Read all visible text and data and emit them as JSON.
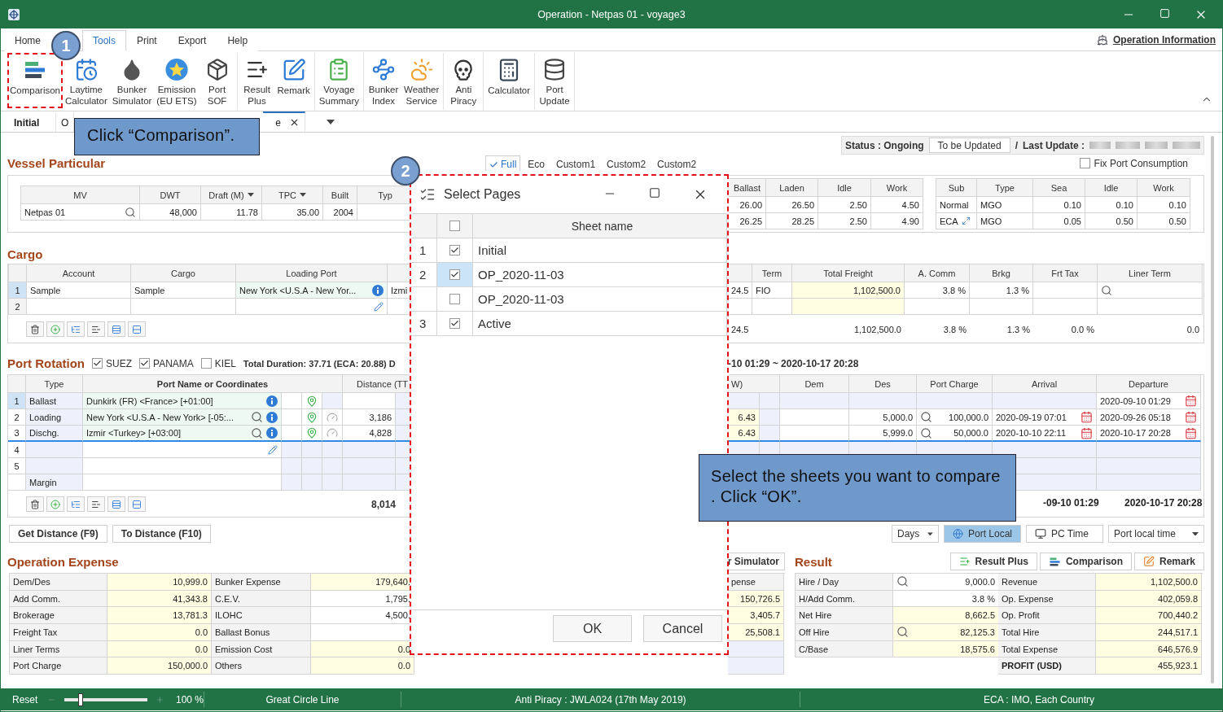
{
  "window": {
    "title": "Operation - Netpas 01 - voyage3"
  },
  "menu": [
    {
      "label": "Home",
      "selected": false
    },
    {
      "label": "Tools",
      "selected": true
    },
    {
      "label": "Print",
      "selected": false
    },
    {
      "label": "Export",
      "selected": false
    },
    {
      "label": "Help",
      "selected": false
    }
  ],
  "operation_information": "Operation Information",
  "ribbon": [
    [
      {
        "label": "Comparison",
        "highlighted": true
      },
      {
        "label": "Laytime\nCalculator",
        "highlighted": false
      },
      {
        "label": "Bunker\nSimulator",
        "highlighted": false
      },
      {
        "label": "Emission\n(EU ETS)",
        "highlighted": false
      },
      {
        "label": "Port\nSOF",
        "highlighted": false
      }
    ],
    [
      {
        "label": "Result\nPlus",
        "highlighted": false
      },
      {
        "label": "Remark",
        "highlighted": false
      }
    ],
    [
      {
        "label": "Voyage\nSummary",
        "highlighted": false
      }
    ],
    [
      {
        "label": "Bunker\nIndex",
        "highlighted": false
      },
      {
        "label": "Weather\nService",
        "highlighted": false
      }
    ],
    [
      {
        "label": "Anti\nPiracy",
        "highlighted": false
      }
    ],
    [
      {
        "label": "Calculator",
        "highlighted": false
      }
    ],
    [
      {
        "label": "Port\nUpdate",
        "highlighted": false
      }
    ]
  ],
  "sheet_tabs": [
    {
      "label": "Initial",
      "selected": false,
      "closable": false
    },
    {
      "label": "O",
      "selected": false,
      "closable": false
    },
    {
      "label": "e",
      "selected": true,
      "closable": true
    }
  ],
  "status": {
    "label": "Status : Ongoing",
    "button": "To be Updated",
    "separator": "/",
    "last_update": "Last Update :"
  },
  "vessel": {
    "title": "Vessel Particular",
    "view_modes": [
      {
        "label": "Full",
        "selected": true
      },
      {
        "label": "Eco",
        "selected": false
      },
      {
        "label": "Custom1",
        "selected": false
      },
      {
        "label": "Custom2",
        "selected": false
      },
      {
        "label": "Custom2",
        "selected": false
      }
    ],
    "fix_port_consumption": {
      "label": "Fix Port Consumption",
      "checked": false
    },
    "particulars": {
      "columns": [
        "MV",
        "DWT",
        "Draft (M)",
        "TPC",
        "Built",
        "Typ"
      ],
      "rows": [
        [
          "Netpas 01",
          "48,000",
          "11.78",
          "35.00",
          "2004"
        ]
      ]
    },
    "speeds": {
      "columns": [
        "Ballast",
        "Laden",
        "Idle",
        "Work"
      ],
      "rows": [
        [
          "26.00",
          "26.50",
          "2.50",
          "4.50"
        ],
        [
          "26.25",
          "28.25",
          "2.50",
          "4.90"
        ]
      ]
    },
    "consumption": {
      "columns": [
        "Sub",
        "Type",
        "Sea",
        "Idle",
        "Work"
      ],
      "rows": [
        [
          "Normal",
          "MGO",
          "0.10",
          "0.10",
          "0.10"
        ],
        [
          "ECA",
          "MGO",
          "0.05",
          "0.50",
          "0.50"
        ]
      ]
    }
  },
  "cargo": {
    "title": "Cargo",
    "columns": [
      "Account",
      "Cargo",
      "Loading Port"
    ],
    "rows": [
      {
        "no": "1",
        "selected": true,
        "account": "Sample",
        "cargo": "Sample",
        "loading_port": "New York <U.S.A - New Yor...",
        "column_4": "Izmi",
        "column_5": "24.5",
        "term": "FIO",
        "total_freight": "1,102,500.0",
        "a_comm": "3.8 %",
        "brkg": "1.3 %"
      },
      {
        "no": "2",
        "selected": false
      }
    ],
    "right_columns": [
      "Term",
      "Total Freight",
      "A. Comm",
      "Brkg",
      "Frt Tax",
      "Liner Term"
    ],
    "totals": {
      "column_5": "24.5",
      "total_freight": "1,102,500.0",
      "a_comm": "3.8 %",
      "brkg": "1.3 %",
      "frt_tax": "0.0 %",
      "liner_term": "0.0"
    }
  },
  "port_rotation": {
    "title": "Port Rotation",
    "canals": [
      {
        "label": "SUEZ",
        "checked": true
      },
      {
        "label": "PANAMA",
        "checked": true
      },
      {
        "label": "KIEL",
        "checked": false
      }
    ],
    "duration": "Total Duration: 37.71 (ECA: 20.88) D",
    "period": "-10 01:29 ~ 2020-10-17 20:28",
    "columns": [
      "Type",
      "Port Name or Coordinates",
      "Distance (TT"
    ],
    "right_columns": [
      "W)",
      "Dem",
      "Des",
      "Port Charge",
      "Arrival",
      "Departure"
    ],
    "rows": [
      {
        "kind": "port",
        "no": "1",
        "selected": true,
        "type": "Ballast",
        "port": "Dunkirk (FR) <France> [+01:00]",
        "departure": "2020-09-10 01:29"
      },
      {
        "kind": "port",
        "no": "2",
        "selected": false,
        "type": "Loading",
        "port": "New York <U.S.A - New York> [-05:...",
        "distance": "3,186",
        "column_1": "6.43",
        "des": "5,000.0",
        "port_charge": "100,000.0",
        "arrival": "2020-09-19 07:01",
        "departure": "2020-09-26 05:18"
      },
      {
        "kind": "port",
        "no": "3",
        "selected": false,
        "type": "Dischg.",
        "port": "Izmir <Turkey> [+03:00]",
        "distance": "4,828",
        "column_1": "6.43",
        "des": "5,999.0",
        "port_charge": "50,000.0",
        "arrival": "2020-10-10 22:11",
        "departure": "2020-10-17 20:28"
      },
      {
        "kind": "blank",
        "no": "4",
        "selected": false
      },
      {
        "kind": "blank",
        "no": "5",
        "selected": false
      },
      {
        "kind": "margin",
        "type": "Margin",
        "selected": false
      }
    ],
    "total_distance": "8,014",
    "total_arrival": "-09-10 01:29",
    "total_departure": "2020-10-17 20:28"
  },
  "distance_buttons": [
    "Get Distance (F9)",
    "To Distance (F10)"
  ],
  "time_controls": {
    "unit": "Days",
    "modes": [
      {
        "label": "Port Local",
        "selected": true
      },
      {
        "label": "PC Time",
        "selected": false
      }
    ],
    "time_zone": "Port local time"
  },
  "operation_expense": {
    "title": "Operation Expense",
    "items": [
      {
        "label": "Dem/Des",
        "value": "10,999.0",
        "highlighted": true
      },
      {
        "label": "Add Comm.",
        "value": "41,343.8",
        "highlighted": true
      },
      {
        "label": "Brokerage",
        "value": "13,781.3",
        "highlighted": true
      },
      {
        "label": "Freight Tax",
        "value": "0.0",
        "highlighted": true
      },
      {
        "label": "Liner Terms",
        "value": "0.0",
        "highlighted": true
      },
      {
        "label": "Port Charge",
        "value": "150,000.0",
        "highlighted": true
      },
      {
        "label": "Bunker Expense",
        "value": "179,640.",
        "highlighted": true
      },
      {
        "label": "C.E.V.",
        "value": "1,795.",
        "highlighted": false
      },
      {
        "label": "ILOHC",
        "value": "4,500.",
        "highlighted": false
      },
      {
        "label": "Ballast Bonus",
        "highlighted": false
      },
      {
        "label": "Emission Cost",
        "value": "0.0",
        "highlighted": true
      },
      {
        "label": "Others",
        "value": "0.0",
        "highlighted": true
      }
    ]
  },
  "bunker": {
    "button": "r Simulator",
    "column": "pense",
    "values": [
      "150,726.5",
      "3,405.7",
      "25,508.1"
    ]
  },
  "result": {
    "title": "Result",
    "buttons": [
      "Result Plus",
      "Comparison",
      "Remark"
    ],
    "left": [
      {
        "label": "Hire / Day",
        "value": "9,000.0",
        "lookup": true,
        "highlighted": false
      },
      {
        "label": "H/Add Comm.",
        "value": "3.8 %",
        "lookup": false,
        "highlighted": false
      },
      {
        "label": "Net Hire",
        "value": "8,662.5",
        "lookup": false,
        "highlighted": true
      },
      {
        "label": "Off Hire",
        "value": "82,125.3",
        "lookup": true,
        "highlighted": true
      },
      {
        "label": "C/Base",
        "value": "18,575.6",
        "lookup": false,
        "highlighted": true
      }
    ],
    "right": [
      {
        "label": "Revenue",
        "value": "1,102,500.0",
        "kind": "line"
      },
      {
        "label": "Op. Expense",
        "value": "402,059.8",
        "kind": "line"
      },
      {
        "label": "Op. Profit",
        "value": "700,440.2",
        "kind": "line"
      },
      {
        "label": "Total Hire",
        "value": "244,517.1",
        "kind": "line"
      },
      {
        "label": "Total Expense",
        "value": "646,576.9",
        "kind": "line"
      },
      {
        "label": "PROFIT (USD)",
        "value": "455,923.1",
        "kind": "total"
      }
    ]
  },
  "status_bar": {
    "reset": "Reset",
    "zoom": {
      "level": 0.2,
      "reading": "100 %"
    },
    "items": [
      "Great Circle Line",
      "Anti Piracy : JWLA024 (17th May 2019)",
      "ECA : IMO, Each Country"
    ]
  },
  "dialog": {
    "title": "Select Pages",
    "all_checked": false,
    "column": "Sheet name",
    "rows": [
      {
        "no": "1",
        "checked": true,
        "selected": false,
        "name": "Initial"
      },
      {
        "no": "2",
        "checked": true,
        "selected": true,
        "name": "OP_2020-11-03"
      },
      {
        "checked": false,
        "selected": false,
        "name": "OP_2020-11-03"
      },
      {
        "no": "3",
        "checked": true,
        "selected": false,
        "name": "Active"
      }
    ],
    "buttons": [
      "OK",
      "Cancel"
    ]
  },
  "steps": [
    {
      "number": "1",
      "note": "Click “Comparison”."
    },
    {
      "number": "2",
      "note": "Select the sheets you want to compare . Click “OK”."
    }
  ]
}
